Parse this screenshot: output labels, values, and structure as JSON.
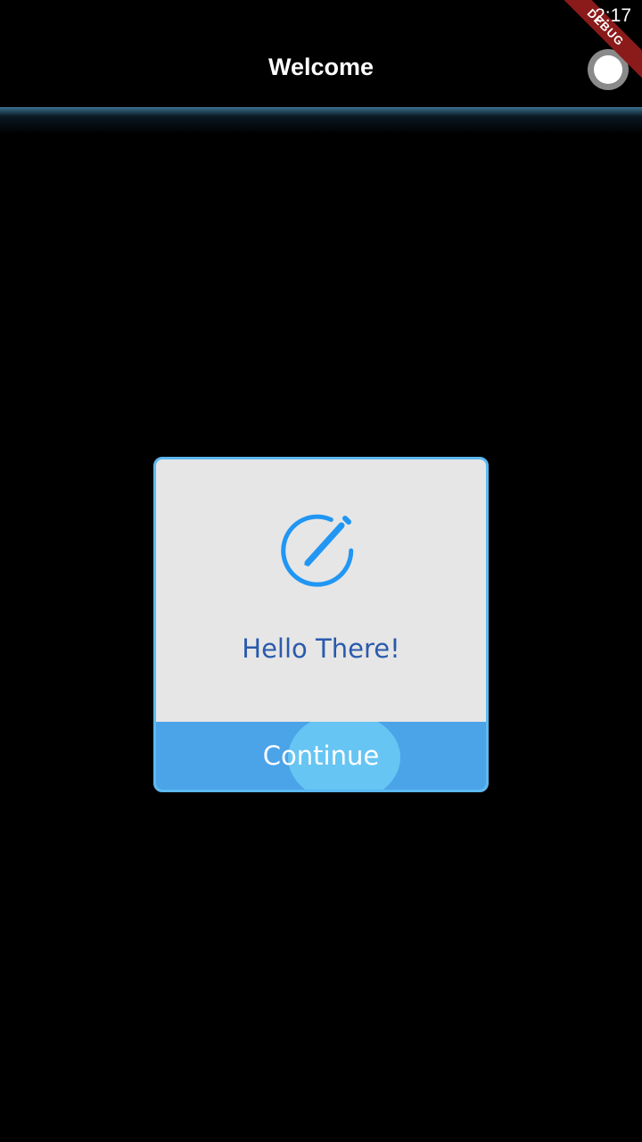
{
  "status_bar": {
    "time": "2:17",
    "debug_label": "DEBUG"
  },
  "app_bar": {
    "title": "Welcome",
    "toggle_icon": "circle-toggle-icon"
  },
  "dialog": {
    "icon": "edit-pencil-circle-icon",
    "message": "Hello There!",
    "button_label": "Continue"
  },
  "colors": {
    "background": "#000000",
    "dialog_background": "#e6e6e6",
    "dialog_border": "#5db9f0",
    "accent_blue": "#2196f3",
    "message_text": "#2a5aad",
    "button_background": "#4ba3e8",
    "ripple": "#66c5f3"
  }
}
